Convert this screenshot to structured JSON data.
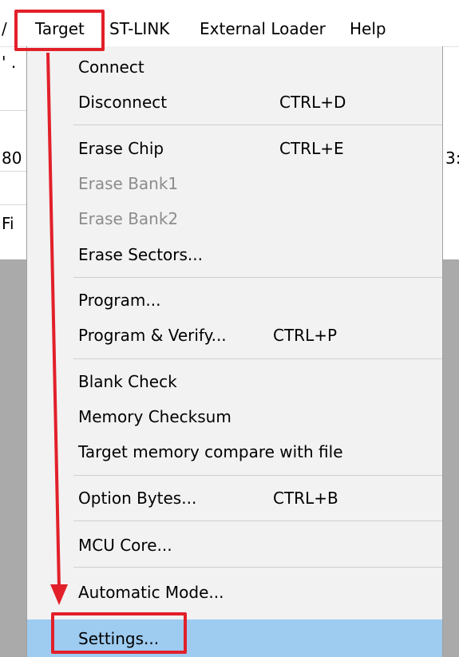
{
  "menubar": {
    "left_edge_char": "/",
    "items": [
      {
        "label": "Target"
      },
      {
        "label": "ST-LINK"
      },
      {
        "label": "External Loader"
      },
      {
        "label": "Help"
      }
    ]
  },
  "background": {
    "left_fragments": [
      "' .",
      "80",
      "Fi"
    ],
    "right_fragments": [
      "3:"
    ]
  },
  "target_menu": {
    "items": [
      {
        "label": "Connect",
        "shortcut": ""
      },
      {
        "label": "Disconnect",
        "shortcut": "CTRL+D"
      },
      {
        "label": "Erase Chip",
        "shortcut": "CTRL+E"
      },
      {
        "label": "Erase Bank1",
        "shortcut": "",
        "disabled": true
      },
      {
        "label": "Erase Bank2",
        "shortcut": "",
        "disabled": true
      },
      {
        "label": "Erase Sectors...",
        "shortcut": ""
      },
      {
        "label": "Program...",
        "shortcut": ""
      },
      {
        "label": "Program & Verify...",
        "shortcut": "CTRL+P"
      },
      {
        "label": "Blank Check",
        "shortcut": ""
      },
      {
        "label": "Memory Checksum",
        "shortcut": ""
      },
      {
        "label": "Target memory compare with file",
        "shortcut": ""
      },
      {
        "label": "Option Bytes...",
        "shortcut": "CTRL+B"
      },
      {
        "label": "MCU Core...",
        "shortcut": ""
      },
      {
        "label": "Automatic Mode...",
        "shortcut": ""
      },
      {
        "label": "Settings...",
        "shortcut": "",
        "highlighted": true
      }
    ]
  },
  "colors": {
    "annotation": "#e2202a",
    "highlight": "#9ecbf0",
    "disabled_text": "#8c8c8c",
    "menu_bg": "#f2f2f2"
  }
}
